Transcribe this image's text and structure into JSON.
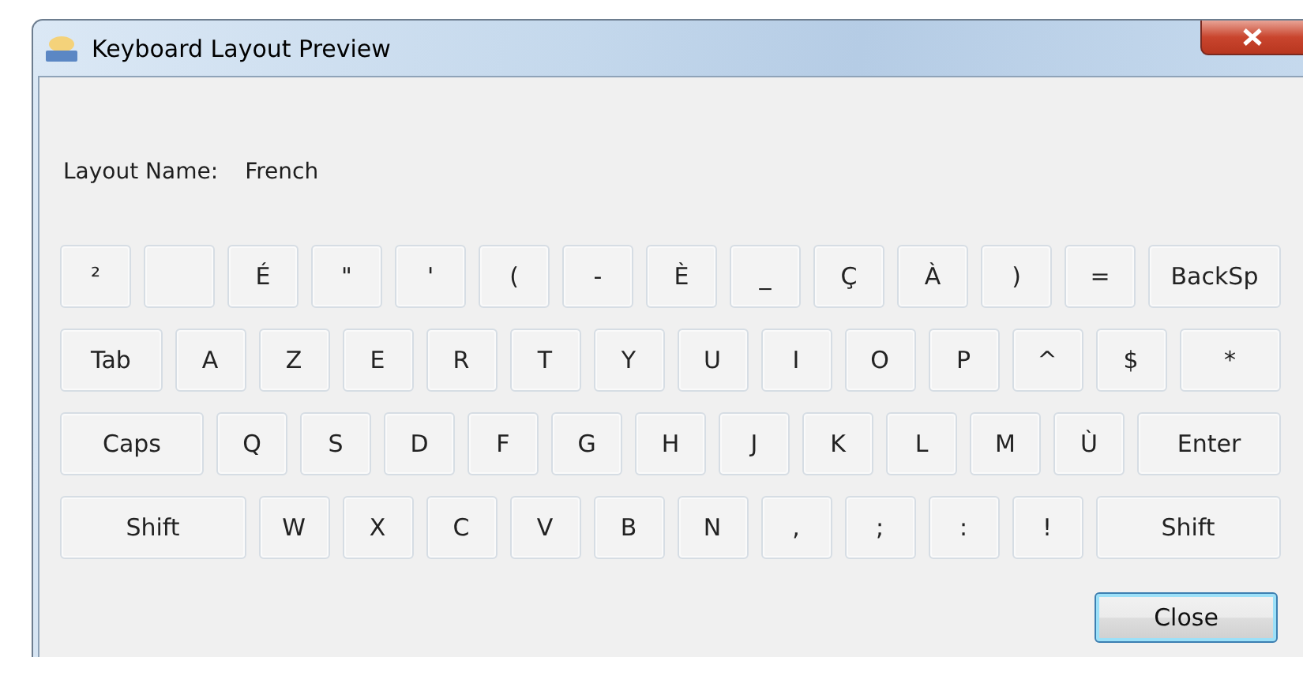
{
  "window": {
    "title": "Keyboard Layout Preview"
  },
  "layout_name": {
    "label": "Layout Name:",
    "value": "French"
  },
  "keyboard_rows": [
    [
      {
        "kind": "char",
        "label": "²"
      },
      {
        "kind": "blank"
      },
      {
        "kind": "char",
        "label": "É"
      },
      {
        "kind": "char",
        "label": "\""
      },
      {
        "kind": "char",
        "label": "'"
      },
      {
        "kind": "char",
        "label": "("
      },
      {
        "kind": "char",
        "label": "-"
      },
      {
        "kind": "char",
        "label": "È"
      },
      {
        "kind": "char",
        "label": "_"
      },
      {
        "kind": "char",
        "label": "Ç"
      },
      {
        "kind": "char",
        "label": "À"
      },
      {
        "kind": "char",
        "label": ")"
      },
      {
        "kind": "char",
        "label": "="
      },
      {
        "kind": "wide",
        "label": "BackSp"
      }
    ],
    [
      {
        "kind": "wide",
        "label": "Tab"
      },
      {
        "kind": "char",
        "label": "A"
      },
      {
        "kind": "char",
        "label": "Z"
      },
      {
        "kind": "char",
        "label": "E"
      },
      {
        "kind": "char",
        "label": "R"
      },
      {
        "kind": "char",
        "label": "T"
      },
      {
        "kind": "char",
        "label": "Y"
      },
      {
        "kind": "char",
        "label": "U"
      },
      {
        "kind": "char",
        "label": "I"
      },
      {
        "kind": "char",
        "label": "O"
      },
      {
        "kind": "char",
        "label": "P"
      },
      {
        "kind": "char",
        "label": "^"
      },
      {
        "kind": "char",
        "label": "$"
      },
      {
        "kind": "wide",
        "label": "*"
      }
    ],
    [
      {
        "kind": "wide",
        "label": "Caps"
      },
      {
        "kind": "char",
        "label": "Q"
      },
      {
        "kind": "char",
        "label": "S"
      },
      {
        "kind": "char",
        "label": "D"
      },
      {
        "kind": "char",
        "label": "F"
      },
      {
        "kind": "char",
        "label": "G"
      },
      {
        "kind": "char",
        "label": "H"
      },
      {
        "kind": "char",
        "label": "J"
      },
      {
        "kind": "char",
        "label": "K"
      },
      {
        "kind": "char",
        "label": "L"
      },
      {
        "kind": "char",
        "label": "M"
      },
      {
        "kind": "char",
        "label": "Ù"
      },
      {
        "kind": "wide",
        "label": "Enter"
      }
    ],
    [
      {
        "kind": "wide",
        "label": "Shift"
      },
      {
        "kind": "char",
        "label": "W"
      },
      {
        "kind": "char",
        "label": "X"
      },
      {
        "kind": "char",
        "label": "C"
      },
      {
        "kind": "char",
        "label": "V"
      },
      {
        "kind": "char",
        "label": "B"
      },
      {
        "kind": "char",
        "label": "N"
      },
      {
        "kind": "char",
        "label": ","
      },
      {
        "kind": "char",
        "label": ";"
      },
      {
        "kind": "char",
        "label": ":"
      },
      {
        "kind": "char",
        "label": "!"
      },
      {
        "kind": "wide",
        "label": "Shift"
      }
    ]
  ],
  "buttons": [
    {
      "label": "Close",
      "default": true
    }
  ]
}
